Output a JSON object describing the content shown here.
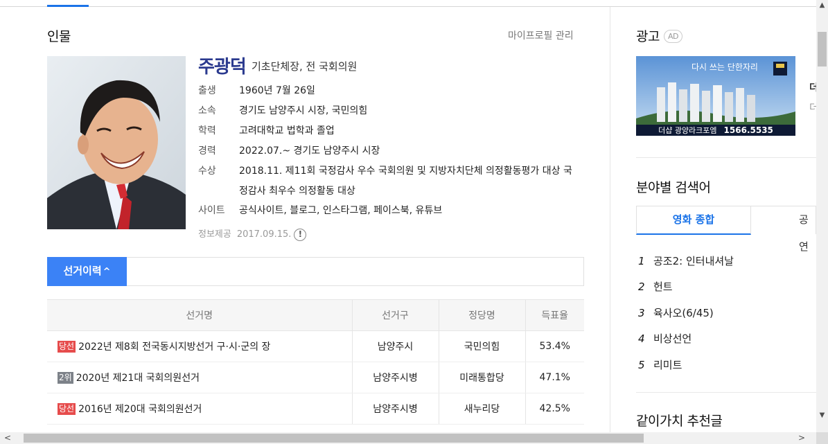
{
  "profile": {
    "section_title": "인물",
    "my_profile_link": "마이프로필 관리",
    "name": "주광덕",
    "description": "기초단체장, 전 국회의원",
    "rows": [
      {
        "label": "출생",
        "value": "1960년 7월 26일"
      },
      {
        "label": "소속",
        "value": "경기도 남양주시 시장, 국민의힘"
      },
      {
        "label": "학력",
        "value": "고려대학교 법학과 졸업"
      },
      {
        "label": "경력",
        "value": "2022.07.~ 경기도 남양주시 시장"
      },
      {
        "label": "수상",
        "value": "2018.11. 제11회 국정감사 우수 국회의원 및 지방자치단체 의정활동평가 대상 국정감사 최우수 의정활동 대상"
      },
      {
        "label": "사이트",
        "value": "공식사이트, 블로그, 인스타그램, 페이스북, 유튜브"
      }
    ],
    "source_label": "정보제공",
    "source_date": "2017.09.15.",
    "source_info_icon": "info-exclamation-icon"
  },
  "election": {
    "tab_label": "선거이력",
    "tab_icon": "chevron-up-icon",
    "headers": [
      "선거명",
      "선거구",
      "정당명",
      "득표율"
    ],
    "rows": [
      {
        "result": "당선",
        "result_type": "win",
        "name": "2022년 제8회 전국동시지방선거 구·시·군의 장",
        "district": "남양주시",
        "party": "국민의힘",
        "rate": "53.4%"
      },
      {
        "result": "2위",
        "result_type": "second",
        "name": "2020년 제21대 국회의원선거",
        "district": "남양주시병",
        "party": "미래통합당",
        "rate": "47.1%"
      },
      {
        "result": "당선",
        "result_type": "win",
        "name": "2016년 제20대 국회의원선거",
        "district": "남양주시병",
        "party": "새누리당",
        "rate": "42.5%"
      }
    ]
  },
  "sidebar": {
    "ad_title": "광고",
    "ad_badge": "AD",
    "ad_banner": {
      "headline": "다시 쓰는 단한자리",
      "brand": "더샵 광양라크포엠",
      "phone": "1566.5535"
    },
    "category_title": "분야별 검색어",
    "tabs": [
      "영화 종합",
      "공연"
    ],
    "ranking": [
      {
        "rank": "1",
        "label": "공조2: 인터내셔날"
      },
      {
        "rank": "2",
        "label": "헌트"
      },
      {
        "rank": "3",
        "label": "육사오(6/45)"
      },
      {
        "rank": "4",
        "label": "비상선언"
      },
      {
        "rank": "5",
        "label": "리미트"
      }
    ],
    "recommend_title": "같이가치 추천글",
    "cut_text_1": "더",
    "cut_text_2": "더"
  },
  "colors": {
    "accent_blue": "#3b82f6",
    "name_color": "#2b3a8f",
    "win_badge": "#e64c4c",
    "second_badge": "#7d8289"
  }
}
